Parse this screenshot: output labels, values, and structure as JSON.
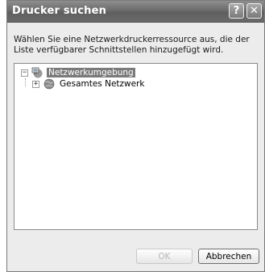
{
  "window": {
    "title": "Drucker suchen",
    "help_glyph": "?",
    "close_glyph": "✕"
  },
  "description": "Wählen Sie eine Netzwerkdruckerressource aus, die der Liste verfügbarer Schnittstellen hinzugefügt wird.",
  "tree": {
    "items": [
      {
        "label": "Netzwerkumgebung",
        "expander": "−",
        "icon": "network-neighborhood-icon",
        "selected": true
      },
      {
        "label": "Gesamtes Netzwerk",
        "expander": "+",
        "icon": "entire-network-globe-icon",
        "selected": false
      }
    ]
  },
  "buttons": {
    "ok_label": "OK",
    "cancel_label": "Abbrechen"
  }
}
